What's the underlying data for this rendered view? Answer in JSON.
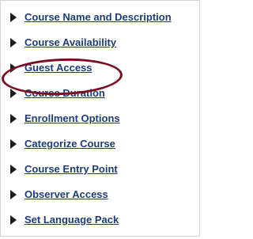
{
  "menu": {
    "items": [
      {
        "label": "Course Name and Description"
      },
      {
        "label": "Course Availability"
      },
      {
        "label": "Guest Access"
      },
      {
        "label": "Course Duration"
      },
      {
        "label": "Enrollment Options"
      },
      {
        "label": "Categorize Course"
      },
      {
        "label": "Course Entry Point"
      },
      {
        "label": "Observer Access"
      },
      {
        "label": "Set Language Pack"
      }
    ]
  },
  "icons": {
    "expand_arrow": "triangle-right-icon"
  },
  "colors": {
    "link": "#1f3b7c",
    "arrow": "#1c1c1c",
    "highlight": "#7a0f22",
    "border": "#d4d4d4"
  }
}
